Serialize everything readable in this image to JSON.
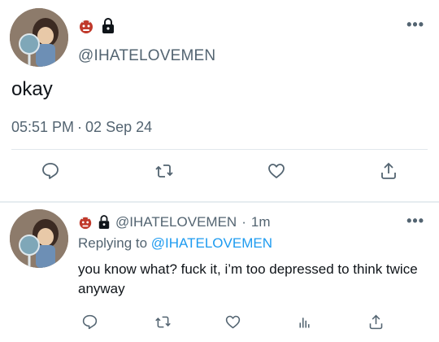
{
  "main_tweet": {
    "handle": "@IHATELOVEMEN",
    "text": "okay",
    "time": "05:51 PM",
    "separator": "·",
    "date": "02 Sep 24",
    "more": "•••"
  },
  "reply_tweet": {
    "handle": "@IHATELOVEMEN",
    "separator": "·",
    "age": "1m",
    "replying_prefix": "Replying to",
    "replying_to": "@IHATELOVEMEN",
    "text": "you know what? fuck it, i’m too depressed to think twice anyway",
    "more": "•••"
  },
  "icons": {
    "badge": "ogre-icon",
    "protected": "lock-icon",
    "actions": [
      "reply-icon",
      "retweet-icon",
      "like-icon",
      "share-icon"
    ],
    "reply_actions": [
      "reply-icon",
      "retweet-icon",
      "like-icon",
      "analytics-icon",
      "share-icon"
    ]
  },
  "colors": {
    "text": "#0f1419",
    "secondary": "#536471",
    "link": "#1d9bf0",
    "divider": "#e1e8ed",
    "ogre": "#c0392b"
  }
}
